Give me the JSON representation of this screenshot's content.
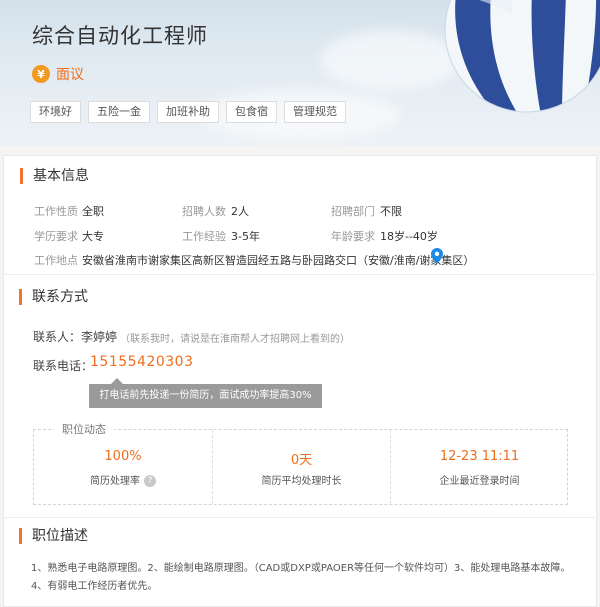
{
  "job": {
    "title": "综合自动化工程师",
    "salary_icon": "¥",
    "salary": "面议",
    "tags": [
      "环境好",
      "五险一金",
      "加班补助",
      "包食宿",
      "管理规范"
    ]
  },
  "basic_info": {
    "section_title": "基本信息",
    "fields": [
      {
        "label": "工作性质",
        "value": "全职"
      },
      {
        "label": "招聘人数",
        "value": "2人"
      },
      {
        "label": "招聘部门",
        "value": "不限"
      },
      {
        "label": "学历要求",
        "value": "大专"
      },
      {
        "label": "工作经验",
        "value": "3-5年"
      },
      {
        "label": "年龄要求",
        "value": "18岁--40岁"
      }
    ],
    "address_label": "工作地点",
    "address": "安徽省淮南市谢家集区高新区智造园经五路与卧园路交口（安徽/淮南/谢家集区）",
    "address_icon": "map-pin-icon"
  },
  "contact": {
    "section_title": "联系方式",
    "name_label": "联系人：",
    "name": "李婷婷",
    "tip": "（联系我时，请说是在淮南帮人才招聘网上看到的）",
    "phone_label": "联系电话：",
    "phone": "15155420303",
    "phone_tooltip": "打电话前先投递一份简历，面试成功率提高30%"
  },
  "dynamics": {
    "title": "职位动态",
    "items": [
      {
        "value": "100%",
        "label": "简历处理率",
        "help": "?"
      },
      {
        "value": "0天",
        "label": "简历平均处理时长"
      },
      {
        "value": "12-23 11:11",
        "label": "企业最近登录时间"
      }
    ]
  },
  "description": {
    "section_title": "职位描述",
    "lines": [
      "1、熟悉电子电路原理图。2、能绘制电路原理图。（CAD或DXP或PAOER等任何一个软件均可）3、能处理电路基本故障。",
      "4、有弱电工作经历者优先。"
    ]
  },
  "colors": {
    "accent": "#f06d1b",
    "section_bar": "#f0742a",
    "pin": "#1e88e5"
  }
}
